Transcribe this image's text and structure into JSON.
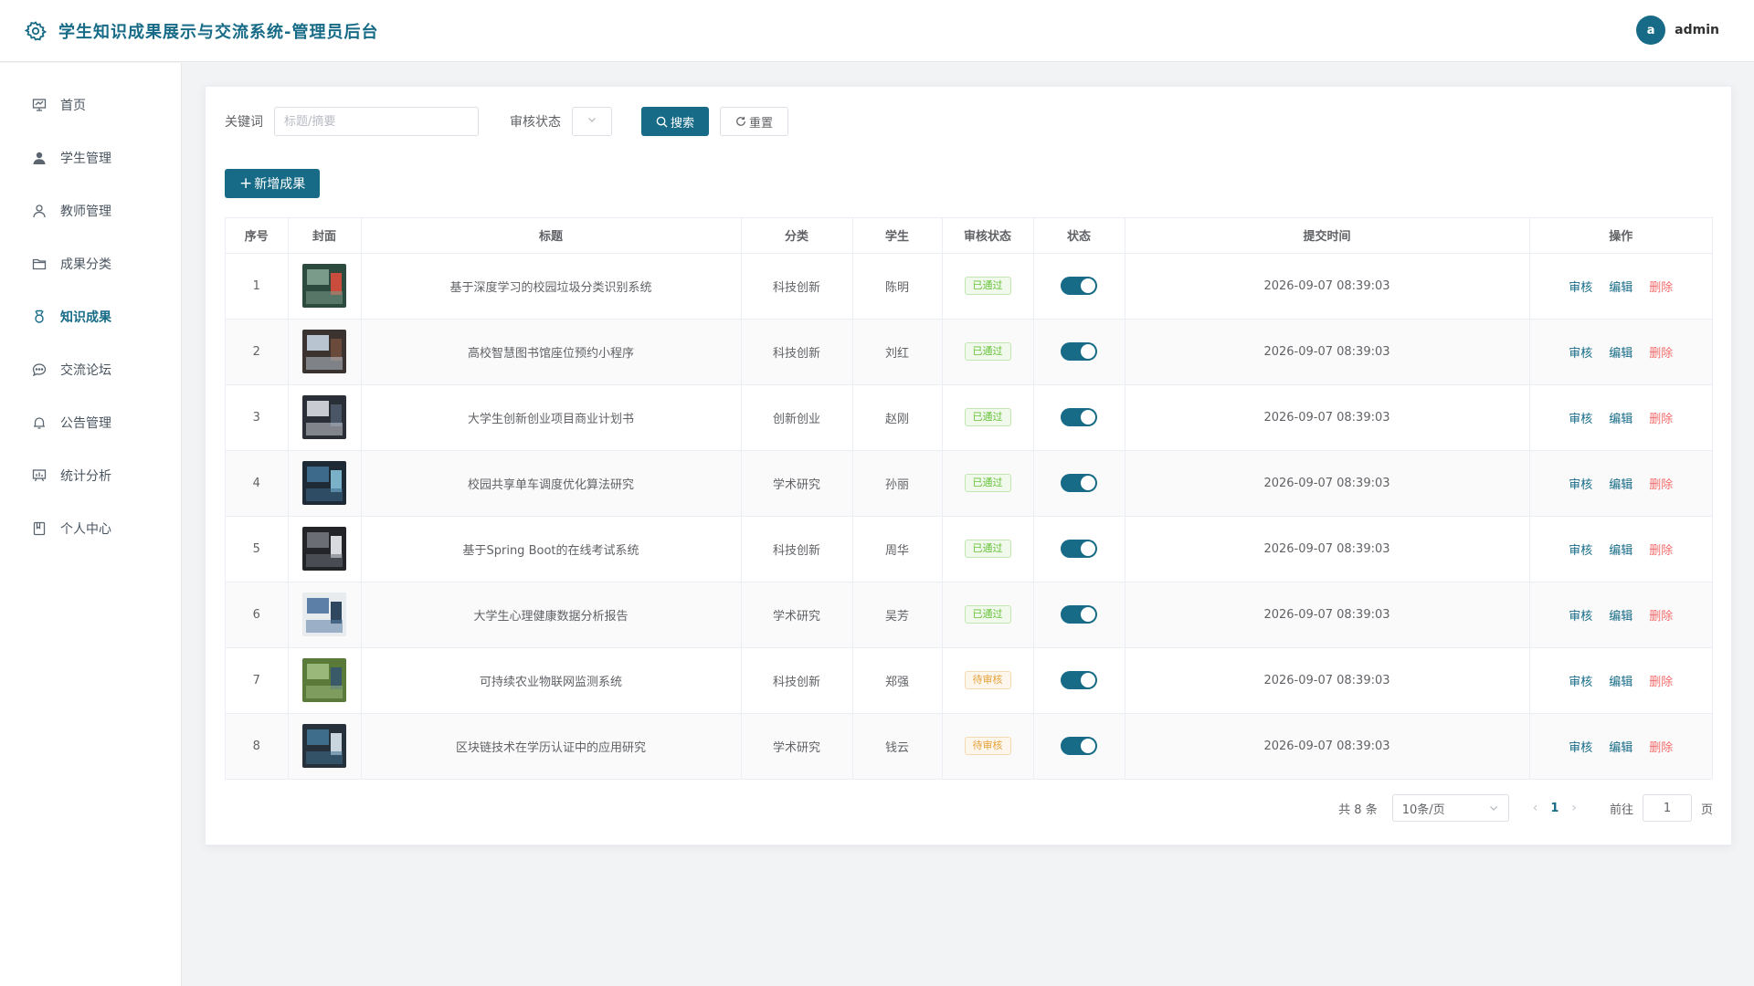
{
  "header": {
    "title": "学生知识成果展示与交流系统-管理员后台",
    "logo_icon": "gear-icon",
    "avatar_letter": "a",
    "username": "admin"
  },
  "sidebar": {
    "items": [
      {
        "label": "首页",
        "icon": "presentation-icon"
      },
      {
        "label": "学生管理",
        "icon": "user-filled-icon"
      },
      {
        "label": "教师管理",
        "icon": "user-outline-icon"
      },
      {
        "label": "成果分类",
        "icon": "folder-icon"
      },
      {
        "label": "知识成果",
        "icon": "medal-icon",
        "active": true
      },
      {
        "label": "交流论坛",
        "icon": "chat-icon"
      },
      {
        "label": "公告管理",
        "icon": "bell-icon"
      },
      {
        "label": "统计分析",
        "icon": "chart-board-icon"
      },
      {
        "label": "个人中心",
        "icon": "notebook-icon"
      }
    ]
  },
  "filters": {
    "keyword_label": "关键词",
    "keyword_placeholder": "标题/摘要",
    "status_label": "审核状态",
    "search_label": "搜索",
    "reset_label": "重置"
  },
  "add_button": "新增成果",
  "table": {
    "columns": [
      "序号",
      "封面",
      "标题",
      "分类",
      "学生",
      "审核状态",
      "状态",
      "提交时间",
      "操作"
    ],
    "rows": [
      {
        "no": "1",
        "title": "基于深度学习的校园垃圾分类识别系统",
        "category": "科技创新",
        "student": "陈明",
        "audit": "已通过",
        "audit_type": "ok",
        "time": "2026-09-07 08:39:03"
      },
      {
        "no": "2",
        "title": "高校智慧图书馆座位预约小程序",
        "category": "科技创新",
        "student": "刘红",
        "audit": "已通过",
        "audit_type": "ok",
        "time": "2026-09-07 08:39:03"
      },
      {
        "no": "3",
        "title": "大学生创新创业项目商业计划书",
        "category": "创新创业",
        "student": "赵刚",
        "audit": "已通过",
        "audit_type": "ok",
        "time": "2026-09-07 08:39:03"
      },
      {
        "no": "4",
        "title": "校园共享单车调度优化算法研究",
        "category": "学术研究",
        "student": "孙丽",
        "audit": "已通过",
        "audit_type": "ok",
        "time": "2026-09-07 08:39:03"
      },
      {
        "no": "5",
        "title": "基于Spring Boot的在线考试系统",
        "category": "科技创新",
        "student": "周华",
        "audit": "已通过",
        "audit_type": "ok",
        "time": "2026-09-07 08:39:03"
      },
      {
        "no": "6",
        "title": "大学生心理健康数据分析报告",
        "category": "学术研究",
        "student": "吴芳",
        "audit": "已通过",
        "audit_type": "ok",
        "time": "2026-09-07 08:39:03"
      },
      {
        "no": "7",
        "title": "可持续农业物联网监测系统",
        "category": "科技创新",
        "student": "郑强",
        "audit": "待审核",
        "audit_type": "wait",
        "time": "2026-09-07 08:39:03"
      },
      {
        "no": "8",
        "title": "区块链技术在学历认证中的应用研究",
        "category": "学术研究",
        "student": "钱云",
        "audit": "待审核",
        "audit_type": "wait",
        "time": "2026-09-07 08:39:03"
      }
    ],
    "actions": {
      "review": "审核",
      "edit": "编辑",
      "delete": "删除"
    }
  },
  "pagination": {
    "total_text": "共 8 条",
    "page_size": "10条/页",
    "current_page": "1",
    "goto_label": "前往",
    "goto_value": "1",
    "page_suffix": "页"
  },
  "colors": {
    "primary": "#176b87",
    "success": "#67c23a",
    "warning": "#e6a23c",
    "danger": "#f56c6c"
  }
}
